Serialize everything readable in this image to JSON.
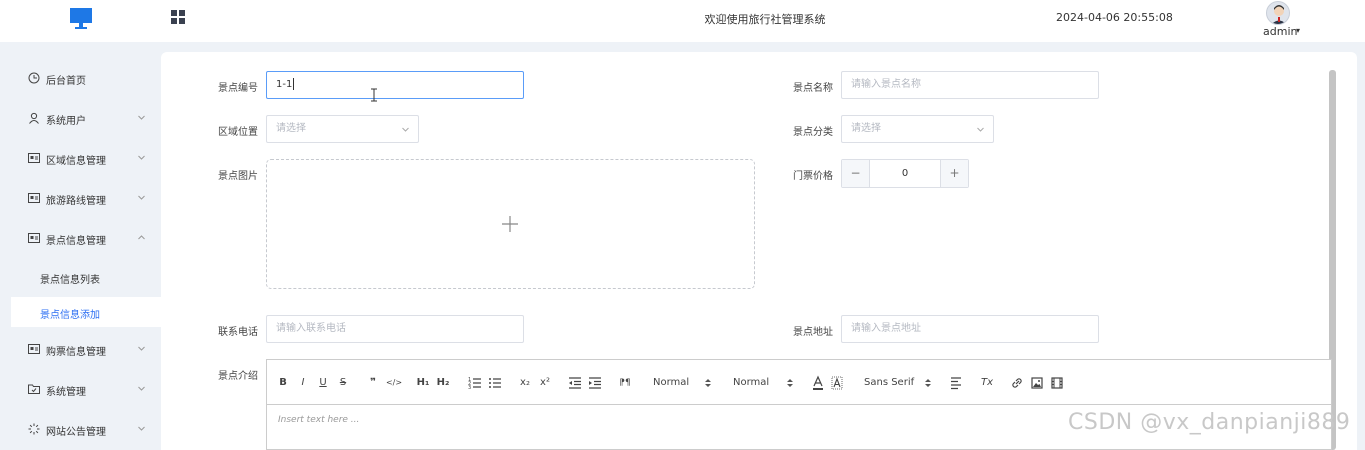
{
  "header": {
    "system_title": "欢迎使用旅行社管理系统",
    "datetime": "2024-04-06 20:55:08",
    "username": "admin"
  },
  "sidebar": {
    "items": [
      {
        "label": "后台首页",
        "icon": "clock-icon",
        "has_arrow": false
      },
      {
        "label": "系统用户",
        "icon": "user-icon",
        "has_arrow": true
      },
      {
        "label": "区域信息管理",
        "icon": "card-icon",
        "has_arrow": true
      },
      {
        "label": "旅游路线管理",
        "icon": "card-icon",
        "has_arrow": true
      },
      {
        "label": "景点信息管理",
        "icon": "card-icon",
        "has_arrow": true,
        "expanded": true
      },
      {
        "label": "购票信息管理",
        "icon": "card-icon",
        "has_arrow": true
      },
      {
        "label": "系统管理",
        "icon": "folder-icon",
        "has_arrow": true
      },
      {
        "label": "网站公告管理",
        "icon": "loading-icon",
        "has_arrow": true
      }
    ],
    "sub_items": [
      {
        "label": "景点信息列表",
        "active": false
      },
      {
        "label": "景点信息添加",
        "active": true
      }
    ]
  },
  "form": {
    "spot_no": {
      "label": "景点编号",
      "value": "1-1"
    },
    "spot_name": {
      "label": "景点名称",
      "placeholder": "请输入景点名称"
    },
    "region": {
      "label": "区域位置",
      "placeholder": "请选择"
    },
    "category": {
      "label": "景点分类",
      "placeholder": "请选择"
    },
    "image": {
      "label": "景点图片"
    },
    "price": {
      "label": "门票价格",
      "value": "0",
      "minus": "−",
      "plus": "+"
    },
    "phone": {
      "label": "联系电话",
      "placeholder": "请输入联系电话"
    },
    "address": {
      "label": "景点地址",
      "placeholder": "请输入景点地址"
    },
    "intro": {
      "label": "景点介绍",
      "placeholder": "Insert text here ..."
    }
  },
  "editor_toolbar": {
    "bold": "B",
    "italic": "I",
    "underline": "U",
    "strike": "S",
    "blockquote": "❞",
    "code": "</>",
    "h1": "H₁",
    "h2": "H₂",
    "sub": "x₂",
    "sup": "x²",
    "rtl": "⁋¶",
    "size_select": "Normal",
    "header_select": "Normal",
    "font_select": "Sans Serif",
    "clean": "Tx"
  },
  "colors": {
    "accent": "#2d6ff3",
    "logo_blue": "#1e78e6",
    "border": "#dcdfe6",
    "placeholder": "#b5b9c2"
  },
  "watermark": "CSDN @vx_danpianji889"
}
